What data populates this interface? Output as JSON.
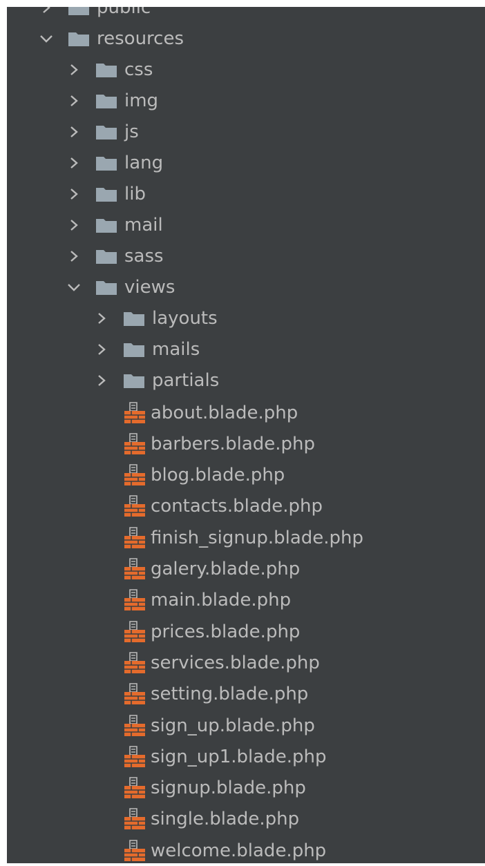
{
  "tree": {
    "top_cut": {
      "label": "public",
      "expanded": false
    },
    "resources": {
      "label": "resources",
      "expanded": true
    },
    "resource_folders": [
      {
        "label": "css"
      },
      {
        "label": "img"
      },
      {
        "label": "js"
      },
      {
        "label": "lang"
      },
      {
        "label": "lib"
      },
      {
        "label": "mail"
      },
      {
        "label": "sass"
      }
    ],
    "views": {
      "label": "views",
      "expanded": true
    },
    "view_folders": [
      {
        "label": "layouts"
      },
      {
        "label": "mails"
      },
      {
        "label": "partials"
      }
    ],
    "view_files": [
      {
        "label": "about.blade.php"
      },
      {
        "label": "barbers.blade.php"
      },
      {
        "label": "blog.blade.php"
      },
      {
        "label": "contacts.blade.php"
      },
      {
        "label": "finish_signup.blade.php"
      },
      {
        "label": "galery.blade.php"
      },
      {
        "label": "main.blade.php"
      },
      {
        "label": "prices.blade.php"
      },
      {
        "label": "services.blade.php"
      },
      {
        "label": "setting.blade.php"
      },
      {
        "label": "sign_up.blade.php"
      },
      {
        "label": "sign_up1.blade.php"
      },
      {
        "label": "signup.blade.php"
      },
      {
        "label": "single.blade.php"
      },
      {
        "label": "welcome.blade.php"
      }
    ]
  },
  "icons": {
    "folder": "folder-icon",
    "blade_file": "blade-file-icon",
    "collapsed": "chevron-right-icon",
    "expanded": "chevron-down-icon"
  },
  "colors": {
    "background": "#3c3f41",
    "text": "#bbbbbb",
    "folder": "#9aa7b0",
    "blade": "#e56b2c"
  }
}
